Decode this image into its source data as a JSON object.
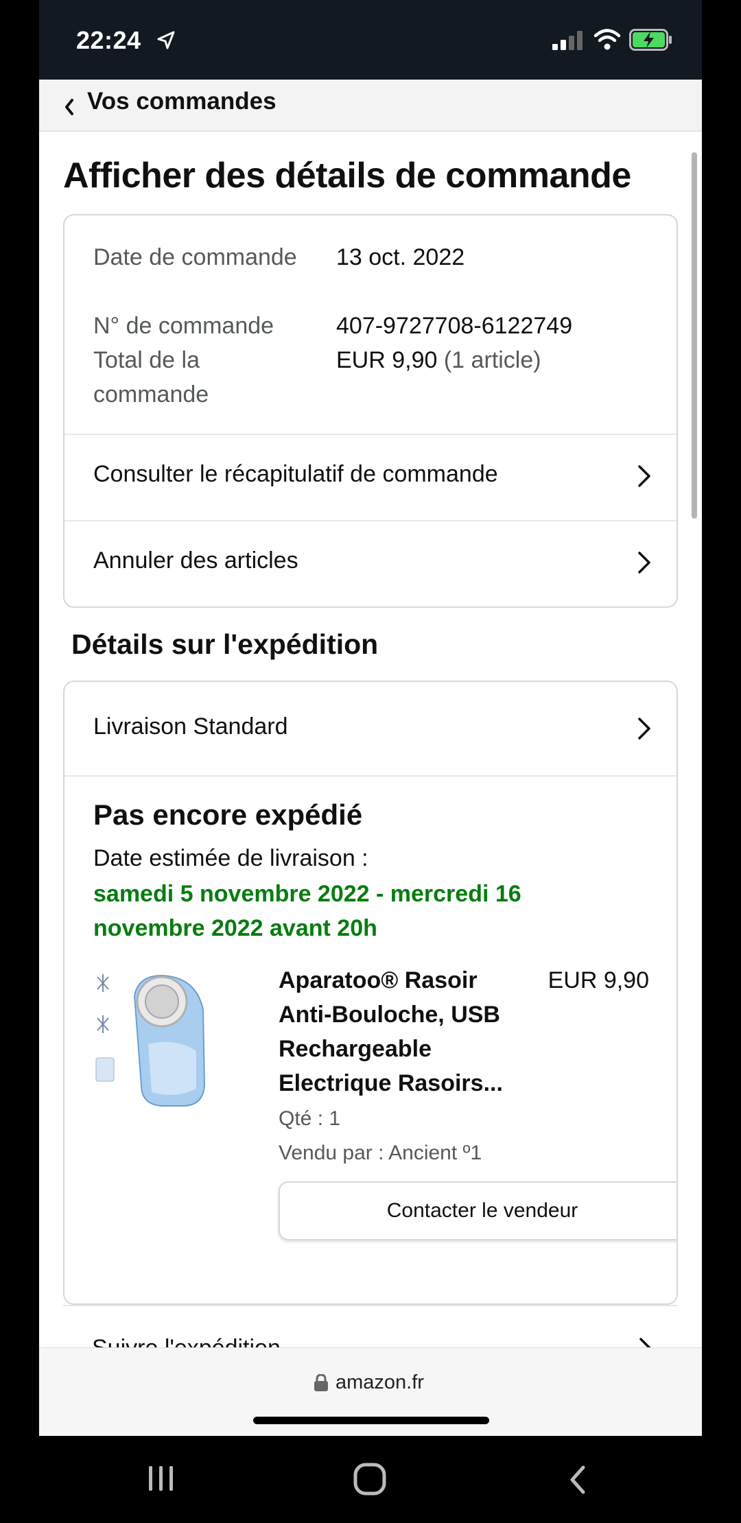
{
  "status_bar": {
    "time": "22:24"
  },
  "nav": {
    "back_label": "Vos commandes"
  },
  "page": {
    "title": "Afficher des détails de commande"
  },
  "order": {
    "date_label": "Date de commande",
    "date_value": "13 oct. 2022",
    "number_label": "N° de commande",
    "number_value": "407-9727708-6122749",
    "total_label": "Total de la commande",
    "total_value": "EUR 9,90",
    "total_items": "(1 article)",
    "links": [
      {
        "label": "Consulter le récapitulatif de commande"
      },
      {
        "label": "Annuler des articles"
      }
    ]
  },
  "shipment": {
    "section_title": "Détails sur l'expédition",
    "method": "Livraison Standard",
    "status": "Pas encore expédié",
    "eta_label": "Date estimée de livraison :",
    "eta_value": "samedi 5 novembre 2022 - mercredi 16 novembre 2022 avant 20h",
    "product": {
      "title": "Aparatoo® Rasoir Anti-Bouloche, USB Rechargeable Electrique Rasoirs...",
      "price": "EUR 9,90",
      "qty": "Qté : 1",
      "seller": "Vendu par : Ancient º1",
      "contact_button": "Contacter le vendeur"
    },
    "track_label": "Suivre l'expédition"
  },
  "browser": {
    "url": "amazon.fr"
  },
  "colors": {
    "eta_green": "#067d0f",
    "header_bg": "#131921",
    "battery_green": "#4cd964"
  },
  "icons": [
    "location-arrow-icon",
    "signal-icon",
    "wifi-icon",
    "battery-charging-icon",
    "chevron-left-icon",
    "chevron-right-icon",
    "lock-icon",
    "recent-apps-icon",
    "home-icon",
    "back-icon"
  ]
}
